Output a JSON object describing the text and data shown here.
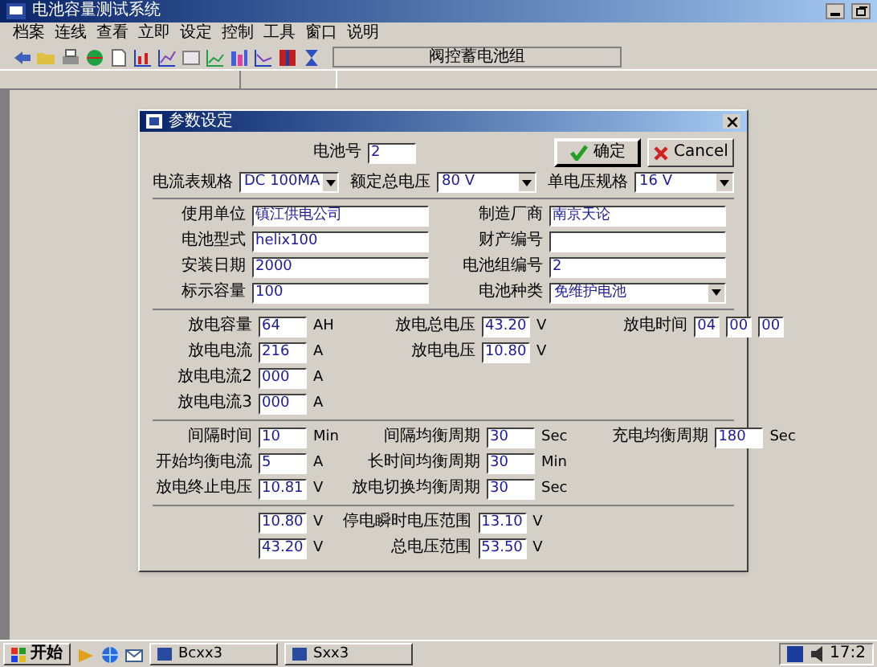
{
  "window": {
    "title": "电池容量测试系统"
  },
  "menu": [
    "档案",
    "连线",
    "查看",
    "立即",
    "设定",
    "控制",
    "工具",
    "窗口",
    "说明"
  ],
  "toolbar": {
    "label": "阀控蓄电池组"
  },
  "dialog": {
    "title": "参数设定",
    "battery_no": {
      "label": "电池号",
      "value": "2"
    },
    "buttons": [
      {
        "label": "确定",
        "kind": "ok"
      },
      {
        "label": "Cancel",
        "kind": "cancel"
      }
    ],
    "specs": [
      {
        "label": "电流表规格",
        "value": "DC 100MA",
        "kind": "select"
      },
      {
        "label": "额定总电压",
        "value": "80 V",
        "kind": "select"
      },
      {
        "label": "单电压规格",
        "value": "16 V",
        "kind": "select"
      }
    ],
    "sections": [
      {
        "kind": "info",
        "fields": [
          {
            "label": "使用单位",
            "value": "镇江供电公司",
            "kind": "text"
          },
          {
            "label": "制造厂商",
            "value": "南京天论",
            "kind": "text"
          },
          {
            "label": "电池型式",
            "value": "helix100",
            "kind": "text"
          },
          {
            "label": "财产编号",
            "kind": "text"
          },
          {
            "label": "安装日期",
            "value": "2000",
            "kind": "text"
          },
          {
            "label": "电池组编号",
            "value": "2",
            "kind": "text"
          },
          {
            "label": "标示容量",
            "value": "100",
            "kind": "text"
          },
          {
            "label": "电池种类",
            "value": "免维护电池",
            "kind": "select"
          }
        ]
      },
      {
        "kind": "grid",
        "fields": [
          {
            "label": "放电容量",
            "value": "64",
            "unit": "AH",
            "kind": "text"
          },
          {
            "label": "放电总电压",
            "value": "43.20",
            "unit": "V",
            "kind": "text"
          },
          {
            "label": "放电时间",
            "values": [
              "04",
              "00",
              "00"
            ],
            "kind": "time"
          },
          {
            "label": "放电电流",
            "value": "216",
            "unit": "A",
            "kind": "text"
          },
          {
            "label": "放电电压",
            "value": "10.80",
            "unit": "V",
            "kind": "text"
          },
          {
            "kind": "blank"
          },
          {
            "label": "放电电流2",
            "value": "000",
            "unit": "A",
            "kind": "text"
          },
          {
            "kind": "blank"
          },
          {
            "kind": "blank"
          },
          {
            "label": "放电电流3",
            "value": "000",
            "unit": "A",
            "kind": "text"
          }
        ]
      },
      {
        "kind": "grid",
        "fields": [
          {
            "label": "间隔时间",
            "value": "10",
            "unit": "Min",
            "kind": "text"
          },
          {
            "label": "间隔均衡周期",
            "value": "30",
            "unit": "Sec",
            "kind": "text"
          },
          {
            "label": "充电均衡周期",
            "value": "180",
            "unit": "Sec",
            "kind": "text"
          },
          {
            "label": "开始均衡电流",
            "value": "5",
            "unit": "A",
            "kind": "text"
          },
          {
            "label": "长时间均衡周期",
            "value": "30",
            "unit": "Min",
            "kind": "text"
          },
          {
            "kind": "blank"
          },
          {
            "label": "放电终止电压",
            "value": "10.81",
            "unit": "V",
            "kind": "text"
          },
          {
            "label": "放电切换均衡周期",
            "value": "30",
            "unit": "Sec",
            "kind": "text"
          }
        ]
      },
      {
        "kind": "grid",
        "fields": [
          {
            "value": "10.80",
            "unit": "V",
            "kind": "text"
          },
          {
            "label": "停电瞬时电压范围",
            "value": "13.10",
            "unit": "V",
            "kind": "text"
          },
          {
            "kind": "blank"
          },
          {
            "value": "43.20",
            "unit": "V",
            "kind": "text"
          },
          {
            "label": "总电压范围",
            "value": "53.50",
            "unit": "V",
            "kind": "text"
          }
        ]
      }
    ]
  },
  "taskbar": {
    "start": "开始",
    "tasks": [
      "Bcxx3",
      "Sxx3"
    ],
    "clock": "17:2"
  }
}
